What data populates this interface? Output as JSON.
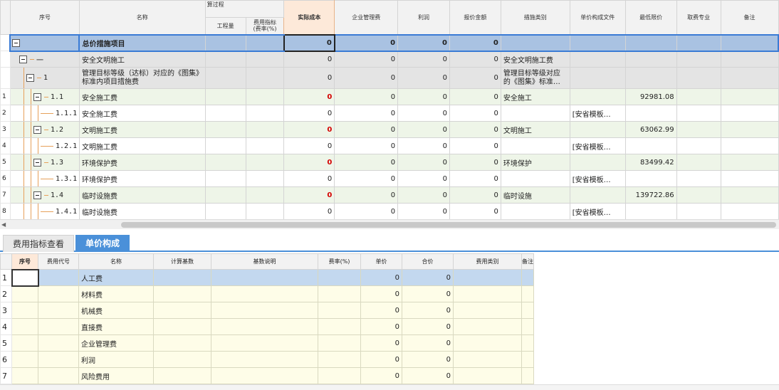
{
  "top_table": {
    "headers": {
      "seq": "序号",
      "name": "名称",
      "calc_group": "算过程",
      "quantity": "工程量",
      "rate": "费用指标\n(费率(%)",
      "actual_cost": "实际成本",
      "mgmt_fee": "企业管理费",
      "profit": "利润",
      "quote": "报价金额",
      "category": "措施类别",
      "unit_price_file": "单价构成文件",
      "min_price": "最低限价",
      "specialty": "取费专业",
      "remark": "备注"
    },
    "rows": [
      {
        "rownum": "",
        "code": "",
        "name": "总价措施项目",
        "actual": "0",
        "mgmt": "0",
        "profit": "0",
        "quote": "0",
        "category": "",
        "file": "",
        "min": ""
      },
      {
        "rownum": "",
        "code": "一",
        "name": "安全文明施工",
        "actual": "0",
        "mgmt": "0",
        "profit": "0",
        "quote": "0",
        "category": "安全文明施工费",
        "file": "",
        "min": ""
      },
      {
        "rownum": "",
        "code": "1",
        "name": "管理目标等级（达标）对应的《图集》标准内项目措施费",
        "actual": "0",
        "mgmt": "0",
        "profit": "0",
        "quote": "0",
        "category": "管理目标等级对应的《图集》标准…",
        "file": "",
        "min": ""
      },
      {
        "rownum": "1",
        "code": "1.1",
        "name": "安全施工费",
        "actual": "0",
        "mgmt": "0",
        "profit": "0",
        "quote": "0",
        "category": "安全施工",
        "file": "",
        "min": "92981.08"
      },
      {
        "rownum": "2",
        "code": "1.1.1",
        "name": "安全施工费",
        "actual": "0",
        "mgmt": "0",
        "profit": "0",
        "quote": "0",
        "category": "",
        "file": "[安省模板…",
        "min": ""
      },
      {
        "rownum": "3",
        "code": "1.2",
        "name": "文明施工费",
        "actual": "0",
        "mgmt": "0",
        "profit": "0",
        "quote": "0",
        "category": "文明施工",
        "file": "",
        "min": "63062.99"
      },
      {
        "rownum": "4",
        "code": "1.2.1",
        "name": "文明施工费",
        "actual": "0",
        "mgmt": "0",
        "profit": "0",
        "quote": "0",
        "category": "",
        "file": "[安省模板…",
        "min": ""
      },
      {
        "rownum": "5",
        "code": "1.3",
        "name": "环境保护费",
        "actual": "0",
        "mgmt": "0",
        "profit": "0",
        "quote": "0",
        "category": "环境保护",
        "file": "",
        "min": "83499.42"
      },
      {
        "rownum": "6",
        "code": "1.3.1",
        "name": "环境保护费",
        "actual": "0",
        "mgmt": "0",
        "profit": "0",
        "quote": "0",
        "category": "",
        "file": "[安省模板…",
        "min": ""
      },
      {
        "rownum": "7",
        "code": "1.4",
        "name": "临时设施费",
        "actual": "0",
        "mgmt": "0",
        "profit": "0",
        "quote": "0",
        "category": "临时设施",
        "file": "",
        "min": "139722.86"
      },
      {
        "rownum": "8",
        "code": "1.4.1",
        "name": "临时设施费",
        "actual": "0",
        "mgmt": "0",
        "profit": "0",
        "quote": "0",
        "category": "",
        "file": "[安省模板…",
        "min": ""
      }
    ]
  },
  "tabs": {
    "fee_index": "费用指标查看",
    "unit_price": "单价构成"
  },
  "bottom_table": {
    "headers": {
      "seq": "序号",
      "fee_code": "费用代号",
      "name": "名称",
      "base": "计算基数",
      "base_desc": "基数说明",
      "rate": "费率(%)",
      "unit_price": "单价",
      "total": "合价",
      "fee_type": "费用类别",
      "remark": "备注"
    },
    "rows": [
      {
        "rownum": "1",
        "name": "人工费",
        "unit": "0",
        "total": "0"
      },
      {
        "rownum": "2",
        "name": "材料费",
        "unit": "0",
        "total": "0"
      },
      {
        "rownum": "3",
        "name": "机械费",
        "unit": "0",
        "total": "0"
      },
      {
        "rownum": "4",
        "name": "直接费",
        "unit": "0",
        "total": "0"
      },
      {
        "rownum": "5",
        "name": "企业管理费",
        "unit": "0",
        "total": "0"
      },
      {
        "rownum": "6",
        "name": "利润",
        "unit": "0",
        "total": "0"
      },
      {
        "rownum": "7",
        "name": "风险费用",
        "unit": "0",
        "total": "0"
      }
    ]
  },
  "colors": {
    "accent": "#4a90d9",
    "selected_row": "#a9c2e2",
    "red_value": "#d40000"
  }
}
